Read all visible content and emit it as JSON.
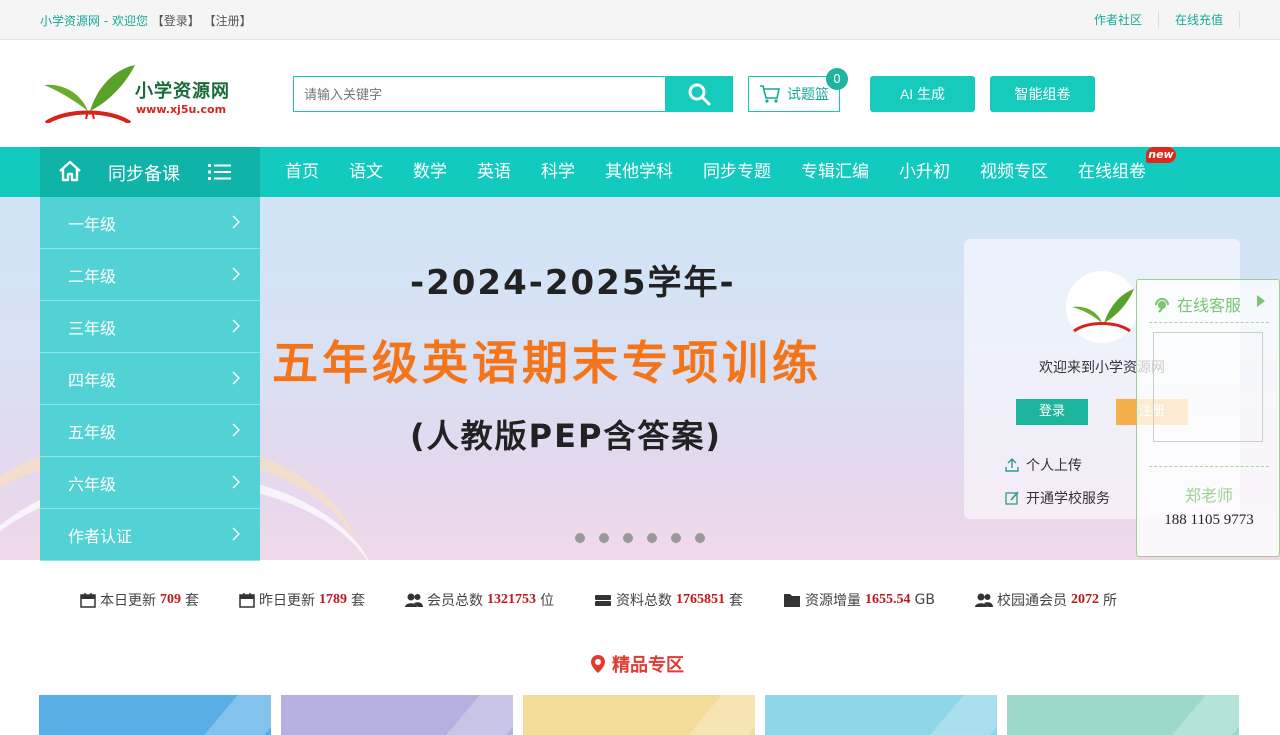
{
  "topbar": {
    "welcome": "小学资源网 - 欢迎您",
    "login": "【登录】",
    "register": "【注册】",
    "links": [
      "作者社区",
      "在线充值"
    ]
  },
  "header": {
    "brand": "小学资源网",
    "url": "www.xj5u.com",
    "search_placeholder": "请输入关键字",
    "cart_label": "试题篮",
    "cart_count": "0",
    "ai_button": "AI 生成",
    "paper_button": "智能组卷"
  },
  "nav": {
    "category_label": "同步备课",
    "items": [
      "首页",
      "语文",
      "数学",
      "英语",
      "科学",
      "其他学科",
      "同步专题",
      "专辑汇编",
      "小升初",
      "视频专区",
      "在线组卷"
    ],
    "new_badge": "new"
  },
  "grades": [
    "一年级",
    "二年级",
    "三年级",
    "四年级",
    "五年级",
    "六年级",
    "作者认证"
  ],
  "banner": {
    "year": "-2024-2025学年-",
    "title": "五年级英语期末专项训练",
    "subtitle": "(人教版PEP含答案)",
    "slide_count": 6
  },
  "login_card": {
    "welcome": "欢迎来到小学资源网",
    "login": "登录",
    "register": "注册",
    "upload": "个人上传",
    "school": "开通学校服务"
  },
  "service": {
    "title": "在线客服",
    "name": "郑老师",
    "phone": "188 1105 9773"
  },
  "stats": [
    {
      "label": "本日更新",
      "value": "709",
      "unit": "套"
    },
    {
      "label": "昨日更新",
      "value": "1789",
      "unit": "套"
    },
    {
      "label": "会员总数",
      "value": "1321753",
      "unit": "位"
    },
    {
      "label": "资料总数",
      "value": "1765851",
      "unit": "套"
    },
    {
      "label": "资源增量",
      "value": "1655.54",
      "unit": "GB"
    },
    {
      "label": "校园通会员",
      "value": "2072",
      "unit": "所"
    }
  ],
  "section_title": "精品专区",
  "colors": {
    "primary": "#12cabe",
    "menu": "#52d2d4",
    "accent_red": "#c0161c",
    "banner_title": "#f4741a",
    "card_colors": [
      "#5aaee6",
      "#b5b0e0",
      "#f3dc9a",
      "#8ed6e8",
      "#9cd8cc"
    ]
  }
}
